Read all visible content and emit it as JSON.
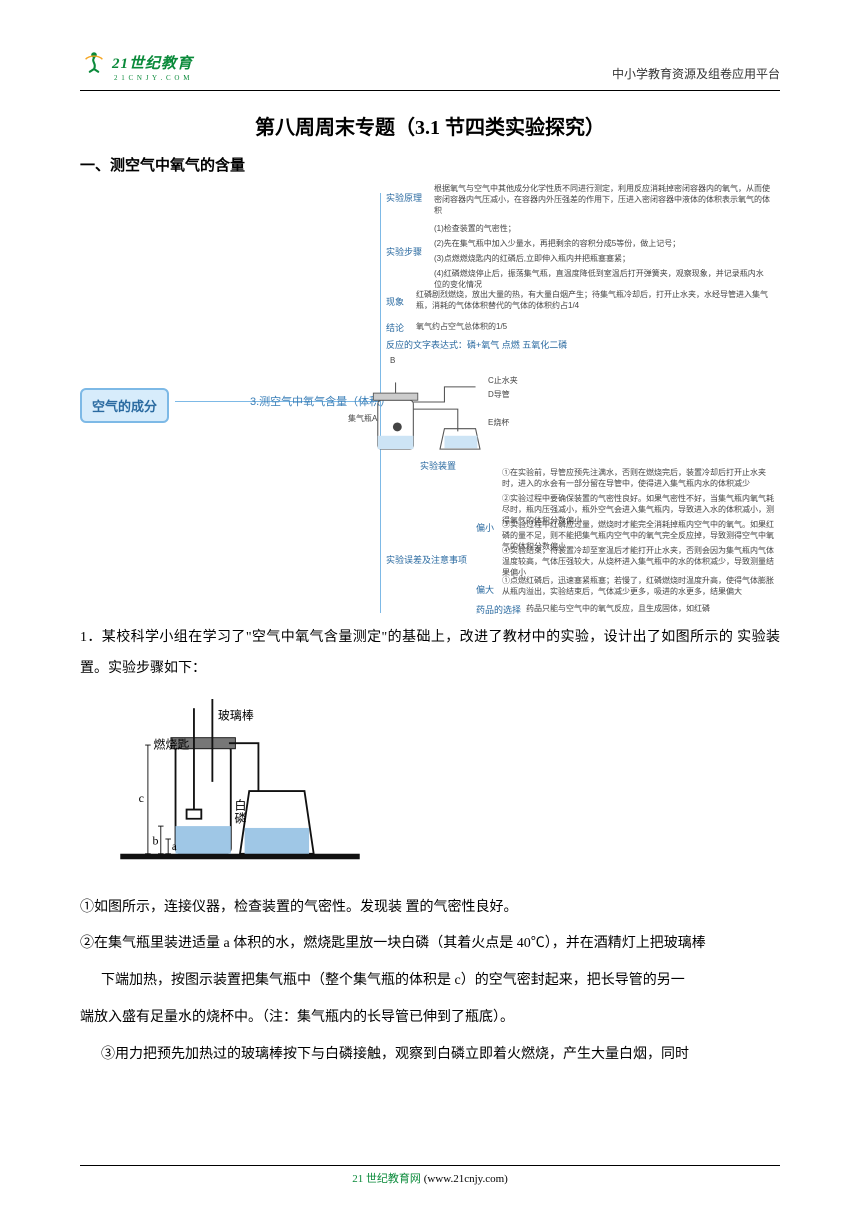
{
  "header": {
    "logo_text": "21世纪教育",
    "logo_sub": "2 1 C N J Y . C O M",
    "right": "中小学教育资源及组卷应用平台"
  },
  "title": "第八周周末专题（3.1 节四类实验探究）",
  "section1_heading": "一、测空气中氧气的含量",
  "mindmap": {
    "root": "空气的成分",
    "branch": "3.测空气中氧气含量（体积）",
    "nodes": {
      "principle_label": "实验原理",
      "principle_text": "根据氧气与空气中其他成分化学性质不同进行测定，利用反应消耗掉密闭容器内的氧气，从而使密闭容器内气压减小，在容器内外压强差的作用下，压进入密闭容器中液体的体积表示氧气的体积",
      "steps_label": "实验步骤",
      "step1": "(1)检查装置的气密性；",
      "step2": "(2)先在集气瓶中加入少量水，再把剩余的容积分成5等份，做上记号；",
      "step3": "(3)点燃燃烧匙内的红磷后,立即伸入瓶内并把瓶塞塞紧；",
      "step4": "(4)红磷燃烧停止后，振荡集气瓶，直温度降低到室温后打开弹簧夹，观察现象，并记录瓶内水位的变化情况",
      "phenomena_label": "现象",
      "phenomena_text": "红磷剧烈燃烧，放出大量的热，有大量白烟产生；待集气瓶冷却后，打开止水夹，水经导管进入集气瓶，消耗的气体体积替代的气体的体积约占1/4",
      "conclusion_label": "结论",
      "conclusion_text": "氧气约占空气总体积的1/5",
      "equation_label": "反应的文字表达式：磷+氧气 点燃 五氧化二磷",
      "apparatus_label": "实验装置",
      "apparatus_letters": {
        "A": "集气瓶A",
        "B": "B",
        "C": "C止水夹",
        "D": "D导管",
        "E": "E烧杯"
      },
      "error_label": "实验误差及注意事项",
      "small_label": "偏小",
      "big_label": "偏大",
      "err1": "①在实验前，导管应预先注满水，否则在燃烧完后，装置冷却后打开止水夹时，进入的水会有一部分留在导管中，使得进入集气瓶内水的体积减少",
      "err2": "②实验过程中要确保装置的气密性良好。如果气密性不好，当集气瓶内氧气耗尽时，瓶内压强减小，瓶外空气会进入集气瓶内，导致进入水的体积减小，测得氧气的体积分数偏小",
      "err3": "③实验过程中红磷应过量，燃烧时才能完全消耗掉瓶内空气中的氧气。如果红磷的量不足，则不能把集气瓶内空气中的氧气完全反应掉，导致测得空气中氧气的体积分数偏小",
      "err4": "④实验结束，待装置冷却至室温后才能打开止水夹，否则会因为集气瓶内气体温度较高，气体压强较大，从烧杯进入集气瓶中的水的体积减少，导致测量结果偏小",
      "err5": "①点燃红磷后，迅速塞紧瓶塞；若慢了，红磷燃烧时温度升高，使得气体膨胀从瓶内溢出，实验结束后，气体减少更多，吸进的水更多，结果偏大",
      "choice_label": "药品的选择",
      "choice_text": "药品只能与空气中的氧气反应，且生成固体，如红磷"
    }
  },
  "q1": {
    "intro": "1．某校科学小组在学习了\"空气中氧气含量测定\"的基础上，改进了教材中的实验，设计出了如图所示的 实验装置。实验步骤如下：",
    "fig_labels": {
      "rod": "玻璃棒",
      "spoon": "燃烧匙",
      "p": "白磷",
      "a": "a",
      "b": "b",
      "c": "c"
    },
    "s1": "①如图所示，连接仪器，检查装置的气密性。发现装 置的气密性良好。",
    "s2": "②在集气瓶里装进适量 a 体积的水，燃烧匙里放一块白磷（其着火点是 40℃），并在酒精灯上把玻璃棒",
    "s3_a": "下端加热，按图示装置把集气瓶中（整个集气瓶的体积是 c）的空气密封起来，把长导管的另一",
    "s3_b": "端放入盛有足量水的烧杯中。（注：集气瓶内的长导管已伸到了瓶底）。",
    "s4": "③用力把预先加热过的玻璃棒按下与白磷接触，观察到白磷立即着火燃烧，产生大量白烟，同时"
  },
  "footer": {
    "brand": "21 世纪教育网",
    "url": "(www.21cnjy.com)"
  }
}
